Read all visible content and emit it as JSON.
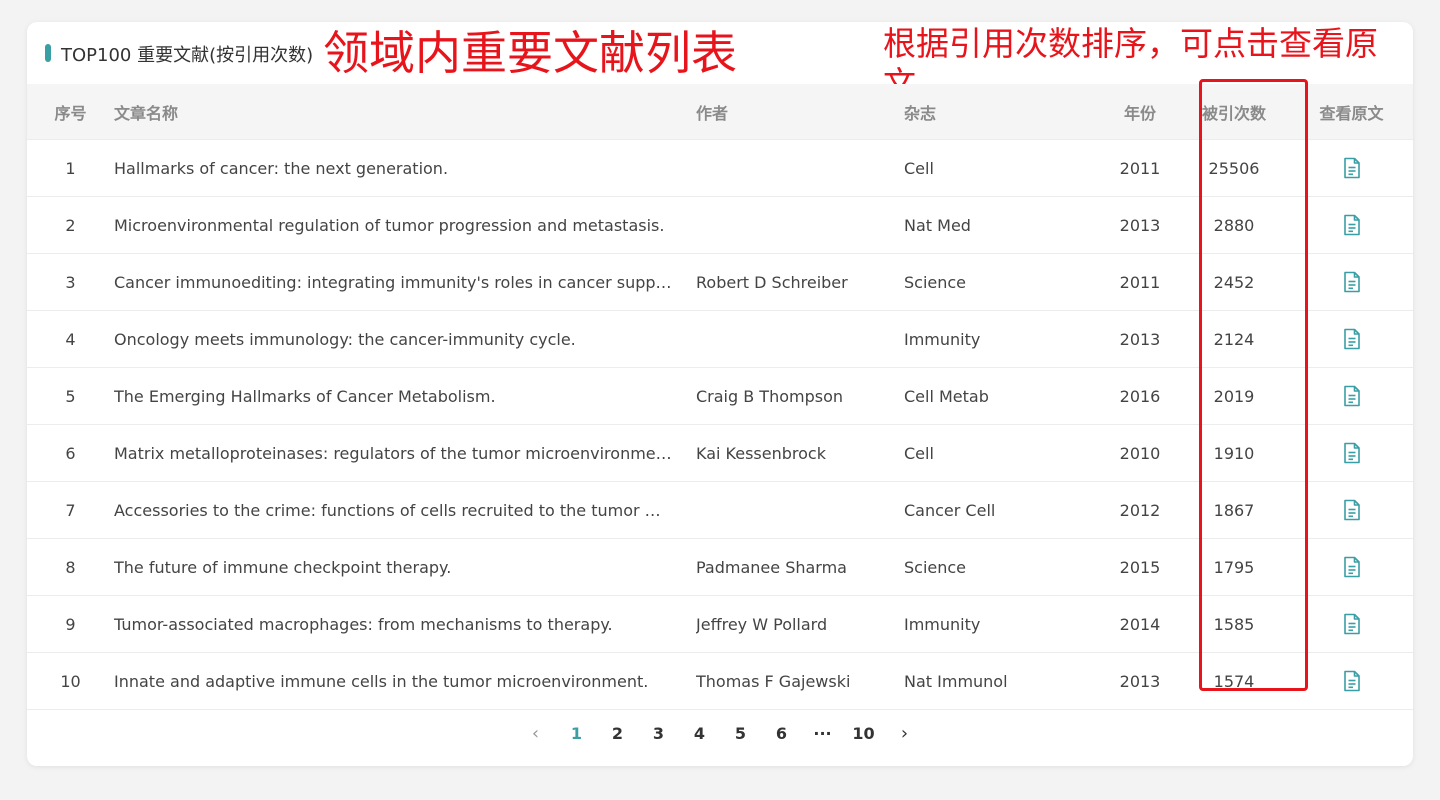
{
  "header": {
    "title": "TOP100 重要文献(按引用次数)",
    "annotation_left": "领域内重要文献列表",
    "annotation_right": "根据引用次数排序，可点击查看原文"
  },
  "colors": {
    "accent": "#3a9ea5",
    "annotation_red": "#e8141b"
  },
  "table": {
    "columns": {
      "index": "序号",
      "title": "文章名称",
      "author": "作者",
      "journal": "杂志",
      "year": "年份",
      "citations": "被引次数",
      "view": "查看原文"
    },
    "view_icon": "document-icon",
    "rows": [
      {
        "index": "1",
        "title": "Hallmarks of cancer: the next generation.",
        "author": "",
        "journal": "Cell",
        "year": "2011",
        "citations": "25506"
      },
      {
        "index": "2",
        "title": "Microenvironmental regulation of tumor progression and metastasis.",
        "author": "",
        "journal": "Nat Med",
        "year": "2013",
        "citations": "2880"
      },
      {
        "index": "3",
        "title": "Cancer immunoediting: integrating immunity's roles in cancer suppres...",
        "author": "Robert D Schreiber",
        "journal": "Science",
        "year": "2011",
        "citations": "2452"
      },
      {
        "index": "4",
        "title": "Oncology meets immunology: the cancer-immunity cycle.",
        "author": "",
        "journal": "Immunity",
        "year": "2013",
        "citations": "2124"
      },
      {
        "index": "5",
        "title": "The Emerging Hallmarks of Cancer Metabolism.",
        "author": "Craig B Thompson",
        "journal": "Cell Metab",
        "year": "2016",
        "citations": "2019"
      },
      {
        "index": "6",
        "title": "Matrix metalloproteinases: regulators of the tumor microenvironment.",
        "author": "Kai Kessenbrock",
        "journal": "Cell",
        "year": "2010",
        "citations": "1910"
      },
      {
        "index": "7",
        "title": "Accessories to the crime: functions of cells recruited to the tumor micr...",
        "author": "",
        "journal": "Cancer Cell",
        "year": "2012",
        "citations": "1867"
      },
      {
        "index": "8",
        "title": "The future of immune checkpoint therapy.",
        "author": "Padmanee Sharma",
        "journal": "Science",
        "year": "2015",
        "citations": "1795"
      },
      {
        "index": "9",
        "title": "Tumor-associated macrophages: from mechanisms to therapy.",
        "author": "Jeffrey W Pollard",
        "journal": "Immunity",
        "year": "2014",
        "citations": "1585"
      },
      {
        "index": "10",
        "title": "Innate and adaptive immune cells in the tumor microenvironment.",
        "author": "Thomas F Gajewski",
        "journal": "Nat Immunol",
        "year": "2013",
        "citations": "1574"
      }
    ]
  },
  "pagination": {
    "prev": "‹",
    "next": "›",
    "pages": [
      "1",
      "2",
      "3",
      "4",
      "5",
      "6",
      "···",
      "10"
    ],
    "current": "1"
  }
}
